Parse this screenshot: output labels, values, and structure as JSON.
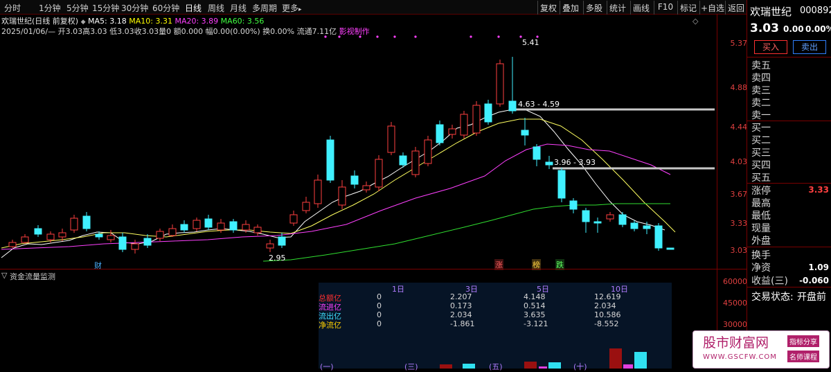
{
  "toolbar": {
    "periods": [
      "分时",
      "1分钟",
      "5分钟",
      "15分钟",
      "30分钟",
      "60分钟",
      "日线",
      "周线",
      "月线",
      "多周期",
      "更多"
    ],
    "active_period": "日线",
    "more_arrow": "▸",
    "right_buttons": [
      "复权",
      "叠加",
      "多股",
      "统计",
      "画线",
      "F10",
      "标记",
      "+自选",
      "返回"
    ]
  },
  "chart": {
    "stock_title": "欢瑞世纪(日线 前复权)",
    "ma_toggle": "◆",
    "ma5_label": "MA5: 3.18",
    "ma10_label": "MA10: 3.31",
    "ma20_label": "MA20: 3.89",
    "ma60_label": "MA60: 3.56",
    "bar_info": {
      "date": "2025/01/06/—",
      "open": "开3.03",
      "high": "高3.03",
      "low": "低3.03",
      "close": "收3.03",
      "volume": "量0",
      "amount": "额0.000",
      "change": "幅0.00(0.00%)",
      "turnover": "换0.00%",
      "float": "流通7.11亿",
      "tag": "影视制作"
    },
    "price_axis": [
      "5.37",
      "4.88",
      "4.44",
      "4.03",
      "3.67",
      "3.33",
      "3.03"
    ],
    "high_marker": "5.41",
    "low_marker": "2.95",
    "gap_label_1": "4.63 - 4.59",
    "gap_label_2": "3.96 - 3.93",
    "event_labels": {
      "cai": "财",
      "zhang": "涨",
      "bang": "榜",
      "die": "跌"
    },
    "settings_icon": "◇"
  },
  "colors": {
    "up": "#ff4040",
    "down": "#40f0ff",
    "ma5": "#ffffff",
    "ma10": "#ffff00",
    "ma20": "#ff40ff",
    "ma60": "#40ff40"
  },
  "subpanel": {
    "title": "资金流量监测",
    "axis": [
      "60000",
      "45000",
      "30000"
    ],
    "table": {
      "headers": [
        "1日",
        "3日",
        "5日",
        "10日"
      ],
      "rows": [
        {
          "label": "总额亿",
          "color": "#ff3030",
          "values": [
            "0",
            "2.207",
            "4.148",
            "12.619"
          ]
        },
        {
          "label": "流进亿",
          "color": "#ff40ff",
          "values": [
            "0",
            "0.173",
            "0.514",
            "2.034"
          ]
        },
        {
          "label": "流出亿",
          "color": "#40e0ff",
          "values": [
            "0",
            "2.034",
            "3.635",
            "10.586"
          ]
        },
        {
          "label": "净流亿",
          "color": "#ffd000",
          "values": [
            "0",
            "-1.861",
            "-3.121",
            "-8.552"
          ]
        }
      ],
      "bottom_tags": [
        "(一)",
        "(三)",
        "(五)",
        "(十)"
      ]
    }
  },
  "right_panel": {
    "name": "欢瑞世纪",
    "code": "000892",
    "price": "3.03",
    "change": "0.00",
    "change_pct": "0.00%",
    "buy_button": "买入",
    "sell_button": "卖出",
    "asks": [
      "卖五",
      "卖四",
      "卖三",
      "卖二",
      "卖一"
    ],
    "bids": [
      "买一",
      "买二",
      "买三",
      "买四",
      "买五"
    ],
    "stats": [
      {
        "label": "涨停",
        "value": "3.33",
        "color": "#ff4040"
      },
      {
        "label": "最高",
        "value": "",
        "color": "#ffffff"
      },
      {
        "label": "最低",
        "value": "",
        "color": "#ffffff"
      },
      {
        "label": "现量",
        "value": "",
        "color": "#ffffff"
      },
      {
        "label": "外盘",
        "value": "",
        "color": "#ffffff"
      },
      {
        "label": "换手",
        "value": "",
        "color": "#ffffff"
      },
      {
        "label": "净资",
        "value": "1.09",
        "color": "#ffffff"
      },
      {
        "label": "收益(三)",
        "value": "-0.060",
        "color": "#ffffff"
      }
    ],
    "status_label": "交易状态:",
    "status_value": "开盘前"
  },
  "watermark": {
    "title": "股市财富网",
    "url": "WWW.GSCFW.COM",
    "tag1": "指标分享",
    "tag2": "名师课程"
  }
}
